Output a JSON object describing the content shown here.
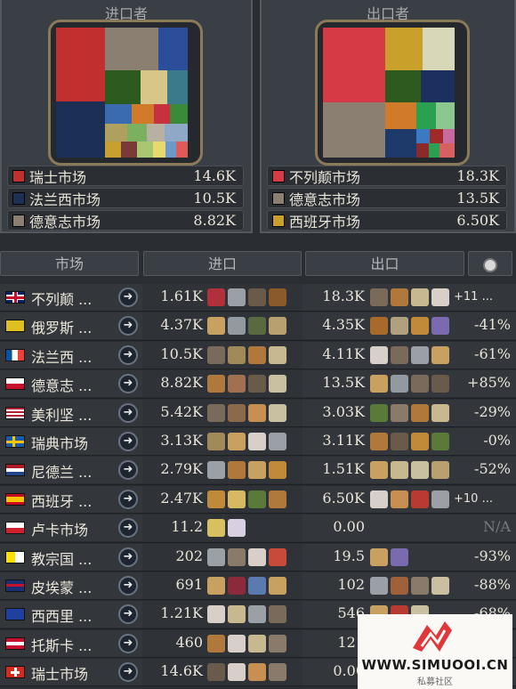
{
  "importers_panel": {
    "title": "进口者",
    "legend": [
      {
        "name": "瑞士市场",
        "value": "14.6K",
        "color": "#c22f2f"
      },
      {
        "name": "法兰西市场",
        "value": "10.5K",
        "color": "#1c2f55"
      },
      {
        "name": "德意志市场",
        "value": "8.82K",
        "color": "#8a7f70"
      }
    ]
  },
  "exporters_panel": {
    "title": "出口者",
    "legend": [
      {
        "name": "不列颠市场",
        "value": "18.3K",
        "color": "#d63a45"
      },
      {
        "name": "德意志市场",
        "value": "13.5K",
        "color": "#8a7f70"
      },
      {
        "name": "西班牙市场",
        "value": "6.50K",
        "color": "#c9a02a"
      }
    ]
  },
  "table_header": {
    "market": "市场",
    "imports": "进口",
    "exports": "出口",
    "sort_icon": "sort-icon"
  },
  "rows": [
    {
      "name": "不列颠 ...",
      "flag": "uk",
      "imports": "1.61K",
      "import_icons": [
        "#b2303a",
        "#9aa0a6",
        "#6a5a4a",
        "#8a5a2a"
      ],
      "import_extra": "",
      "exports": "18.3K",
      "export_icons": [
        "#7a6a5a",
        "#b0783a",
        "#c8b890",
        "#d8d0c8"
      ],
      "export_extra": "+11 ...",
      "change": ""
    },
    {
      "name": "俄罗斯 ...",
      "flag": "russia",
      "imports": "4.37K",
      "import_icons": [
        "#c8a060",
        "#909aa0",
        "#5a6a40",
        "#b8a070"
      ],
      "import_extra": "",
      "exports": "4.35K",
      "export_icons": [
        "#a86a2a",
        "#b0a080",
        "#c08a3a",
        "#7a6ab0"
      ],
      "export_extra": "",
      "change": "-41%"
    },
    {
      "name": "法兰西 ...",
      "flag": "france",
      "imports": "10.5K",
      "import_icons": [
        "#7a6a5a",
        "#a08a5a",
        "#b0783a",
        "#c8b890"
      ],
      "import_extra": "",
      "exports": "4.11K",
      "export_icons": [
        "#d8d0c8",
        "#7a6a5a",
        "#9aa0a6",
        "#c8a060"
      ],
      "export_extra": "",
      "change": "-61%"
    },
    {
      "name": "德意志 ...",
      "flag": "germany",
      "imports": "8.82K",
      "import_icons": [
        "#b0783a",
        "#a07050",
        "#6a5a4a",
        "#c8c0a0"
      ],
      "import_extra": "",
      "exports": "13.5K",
      "export_icons": [
        "#c8a060",
        "#909aa0",
        "#7a6a5a",
        "#6a5a4a"
      ],
      "export_extra": "",
      "change": "+85%"
    },
    {
      "name": "美利坚 ...",
      "flag": "usa",
      "imports": "5.42K",
      "import_icons": [
        "#7a6a5a",
        "#8a6a4a",
        "#c89050",
        "#c8c0a0"
      ],
      "import_extra": "",
      "exports": "3.03K",
      "export_icons": [
        "#5a7a3a",
        "#8a7a6a",
        "#b0783a",
        "#c8b890"
      ],
      "export_extra": "",
      "change": "-29%"
    },
    {
      "name": "瑞典市场",
      "flag": "sweden",
      "imports": "3.13K",
      "import_icons": [
        "#a08a5a",
        "#c8a060",
        "#d8d0c8",
        "#9aa0a6"
      ],
      "import_extra": "",
      "exports": "3.11K",
      "export_icons": [
        "#b0783a",
        "#6a5a4a",
        "#c08a3a",
        "#5a7a3a"
      ],
      "export_extra": "",
      "change": "-0%"
    },
    {
      "name": "尼德兰 ...",
      "flag": "netherlands",
      "imports": "2.79K",
      "import_icons": [
        "#9aa0a6",
        "#b0783a",
        "#c8a060",
        "#c08a3a"
      ],
      "import_extra": "",
      "exports": "1.51K",
      "export_icons": [
        "#c8a060",
        "#c8b890",
        "#c8c0a0",
        "#b8a070"
      ],
      "export_extra": "",
      "change": "-52%"
    },
    {
      "name": "西班牙 ...",
      "flag": "spain",
      "imports": "2.47K",
      "import_icons": [
        "#c08a3a",
        "#d8b860",
        "#5a7a3a",
        "#b0783a"
      ],
      "import_extra": "",
      "exports": "6.50K",
      "export_icons": [
        "#d8d0c8",
        "#c89050",
        "#b83a30",
        "#9aa0a6"
      ],
      "export_extra": "+10 ...",
      "change": ""
    },
    {
      "name": "卢卡市场",
      "flag": "lucca",
      "imports": "11.2",
      "import_icons": [
        "#d8c060",
        "#d8d0e0"
      ],
      "import_extra": "",
      "exports": "0.00",
      "export_icons": [],
      "export_extra": "",
      "change": "N/A"
    },
    {
      "name": "教宗国 ...",
      "flag": "papal",
      "imports": "202",
      "import_icons": [
        "#9aa0a6",
        "#8a7a6a",
        "#d8d0c8",
        "#c84a3a"
      ],
      "import_extra": "",
      "exports": "19.5",
      "export_icons": [
        "#c8a060",
        "#7a6ab0"
      ],
      "export_extra": "",
      "change": "-93%"
    },
    {
      "name": "皮埃蒙 ...",
      "flag": "piedmont",
      "imports": "691",
      "import_icons": [
        "#c8a060",
        "#8a2a3a",
        "#5a7ab0",
        "#c8a060"
      ],
      "import_extra": "",
      "exports": "102",
      "export_icons": [
        "#9aa0a6",
        "#a0603a",
        "#8a7a6a",
        "#c8c0a0"
      ],
      "export_extra": "",
      "change": "-88%"
    },
    {
      "name": "西西里 ...",
      "flag": "sicily",
      "imports": "1.21K",
      "import_icons": [
        "#d8d0c8",
        "#c8b890",
        "#9aa0a6",
        "#7a6a5a"
      ],
      "import_extra": "",
      "exports": "546",
      "export_icons": [
        "#c8a060",
        "#b83a30",
        "#c8c0a0"
      ],
      "export_extra": "",
      "change": "-68%"
    },
    {
      "name": "托斯卡 ...",
      "flag": "tuscany",
      "imports": "460",
      "import_icons": [
        "#b0783a",
        "#d8d0c8",
        "#c8b890",
        "#8a7a6a"
      ],
      "import_extra": "",
      "exports": "121",
      "export_icons": [],
      "export_extra": "",
      "change": ""
    },
    {
      "name": "瑞士市场",
      "flag": "swiss",
      "imports": "14.6K",
      "import_icons": [
        "#6a5a4a",
        "#d8d0c8",
        "#c89050",
        "#8a7a6a"
      ],
      "import_extra": "",
      "exports": "0.00",
      "export_icons": [],
      "export_extra": "",
      "change": ""
    }
  ],
  "watermark": {
    "url": "WWW.SIMUOOI.CN",
    "subtitle": "私募社区",
    "brand_color": "#e2373a"
  }
}
